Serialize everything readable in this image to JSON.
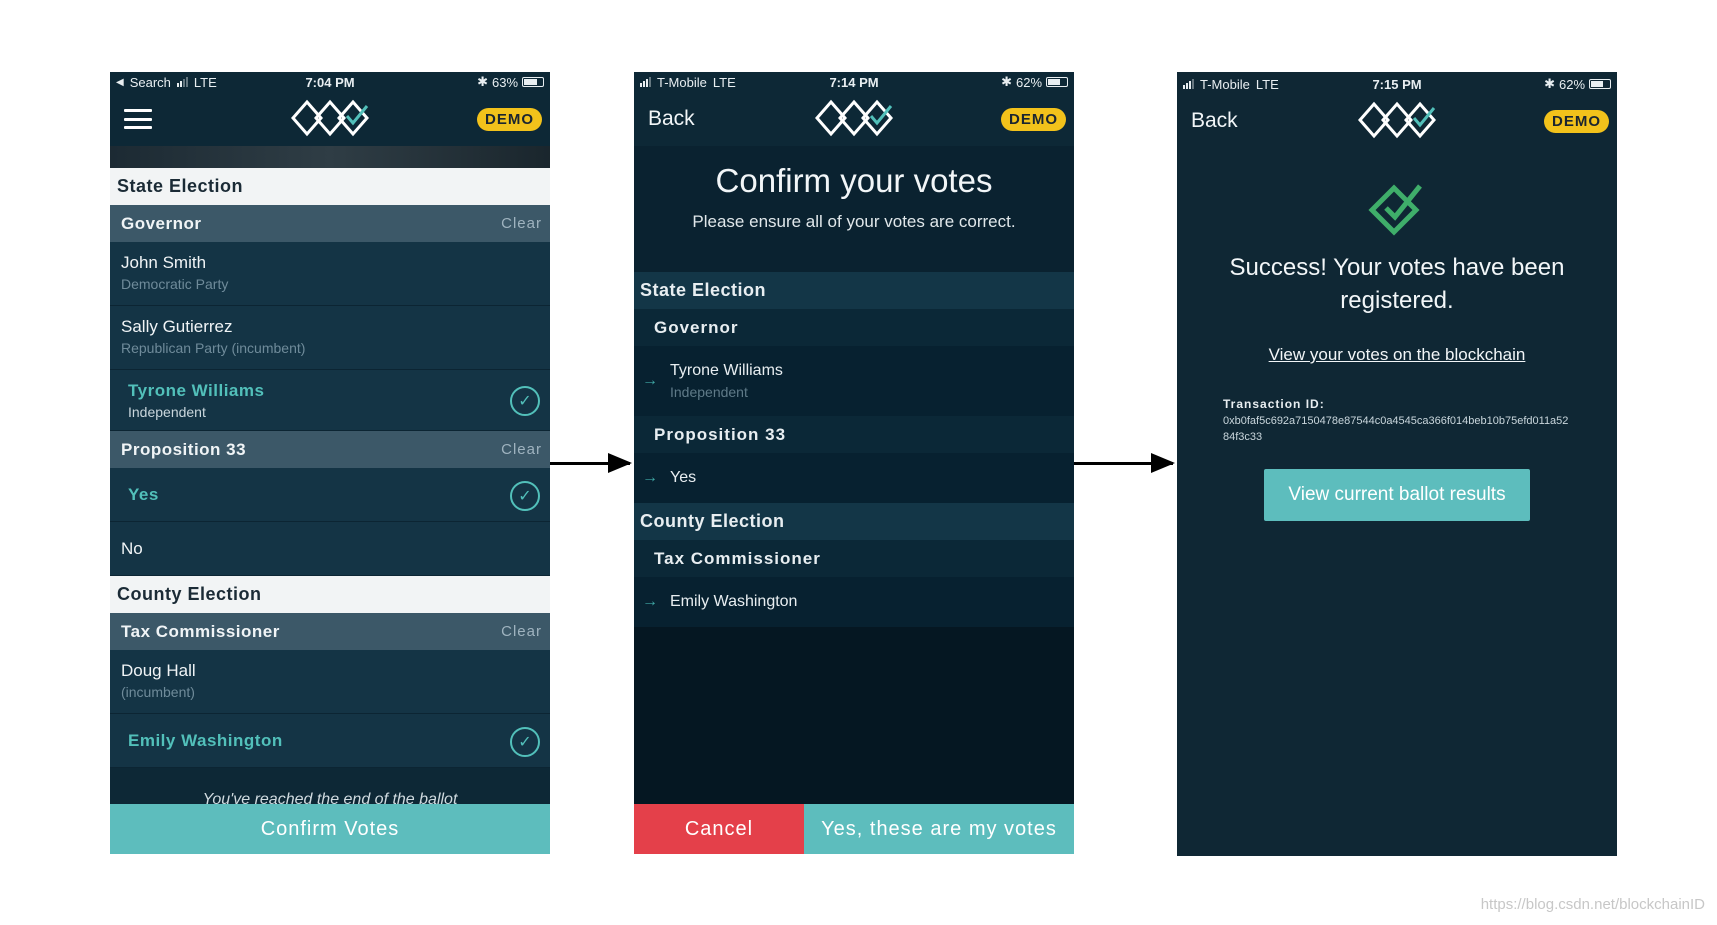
{
  "screen1": {
    "status": {
      "carrier": "Search",
      "network": "LTE",
      "time": "7:04 PM",
      "battery": "63%",
      "battery_level": 0.63
    },
    "demo_label": "DEMO",
    "state_election": {
      "label": "State Election",
      "governor": {
        "title": "Governor",
        "clear": "Clear",
        "candidates": [
          {
            "name": "John Smith",
            "party": "Democratic Party"
          },
          {
            "name": "Sally Gutierrez",
            "party": "Republican Party (incumbent)"
          },
          {
            "name": "Tyrone Williams",
            "party": "Independent"
          }
        ]
      },
      "prop33": {
        "title": "Proposition 33",
        "clear": "Clear",
        "options": [
          "Yes",
          "No"
        ]
      }
    },
    "county_election": {
      "label": "County Election",
      "tax": {
        "title": "Tax Commissioner",
        "clear": "Clear",
        "candidates": [
          {
            "name": "Doug Hall",
            "party": "(incumbent)"
          },
          {
            "name": "Emily Washington",
            "party": ""
          }
        ]
      }
    },
    "end_text": "You've reached the end of the ballot",
    "confirm_button": "Confirm Votes"
  },
  "screen2": {
    "status": {
      "carrier": "T-Mobile",
      "network": "LTE",
      "time": "7:14 PM",
      "battery": "62%",
      "battery_level": 0.62
    },
    "back_label": "Back",
    "demo_label": "DEMO",
    "title": "Confirm your votes",
    "subtitle": "Please ensure all of your votes are correct.",
    "state_label": "State Election",
    "governor_title": "Governor",
    "governor_choice": "Tyrone Williams",
    "governor_party": "Independent",
    "prop_title": "Proposition 33",
    "prop_choice": "Yes",
    "county_label": "County Election",
    "tax_title": "Tax Commissioner",
    "tax_choice": "Emily Washington",
    "cancel_button": "Cancel",
    "yes_button": "Yes, these are my votes"
  },
  "screen3": {
    "status": {
      "carrier": "T-Mobile",
      "network": "LTE",
      "time": "7:15 PM",
      "battery": "62%",
      "battery_level": 0.62
    },
    "back_label": "Back",
    "demo_label": "DEMO",
    "message": "Success! Your votes have been registered.",
    "blockchain_link": "View your votes on the blockchain",
    "tx_label": "Transaction ID:",
    "tx_id": "0xb0faf5c692a7150478e87544c0a4545ca366f014beb10b75efd011a5284f3c33",
    "results_button": "View current ballot results"
  },
  "watermark": "https://blog.csdn.net/blockchainID",
  "colors": {
    "teal": "#5dbdbd",
    "navy": "#0d2836",
    "red": "#e4404a",
    "gold": "#f2c21b",
    "success_green": "#3fae6a"
  }
}
